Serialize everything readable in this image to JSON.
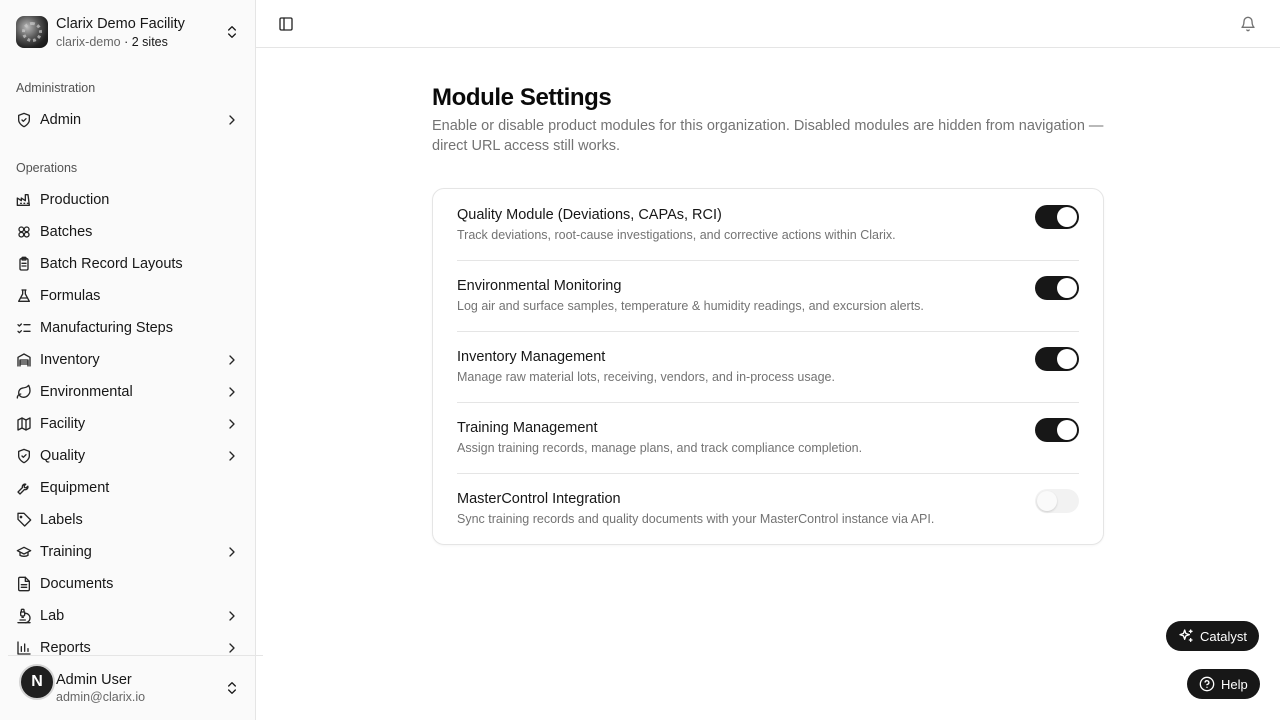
{
  "org": {
    "name": "Clarix Demo Facility",
    "slug": "clarix-demo",
    "sep": "·",
    "sites": "2 sites"
  },
  "sections": {
    "administration": "Administration",
    "operations": "Operations"
  },
  "admin_nav": [
    {
      "label": "Admin",
      "icon": "shield-check-icon",
      "expandable": true
    }
  ],
  "nav": [
    {
      "label": "Production",
      "icon": "factory-icon",
      "expandable": false
    },
    {
      "label": "Batches",
      "icon": "boxes-icon",
      "expandable": false
    },
    {
      "label": "Batch Record Layouts",
      "icon": "clipboard-icon",
      "expandable": false
    },
    {
      "label": "Formulas",
      "icon": "flask-icon",
      "expandable": false
    },
    {
      "label": "Manufacturing Steps",
      "icon": "list-checks-icon",
      "expandable": false
    },
    {
      "label": "Inventory",
      "icon": "warehouse-icon",
      "expandable": true
    },
    {
      "label": "Environmental",
      "icon": "leaf-icon",
      "expandable": true
    },
    {
      "label": "Facility",
      "icon": "map-icon",
      "expandable": true
    },
    {
      "label": "Quality",
      "icon": "shield-check-icon",
      "expandable": true
    },
    {
      "label": "Equipment",
      "icon": "wrench-icon",
      "expandable": false
    },
    {
      "label": "Labels",
      "icon": "tag-icon",
      "expandable": false
    },
    {
      "label": "Training",
      "icon": "graduation-cap-icon",
      "expandable": true
    },
    {
      "label": "Documents",
      "icon": "file-text-icon",
      "expandable": false
    },
    {
      "label": "Lab",
      "icon": "microscope-icon",
      "expandable": true
    },
    {
      "label": "Reports",
      "icon": "bar-chart-icon",
      "expandable": true
    }
  ],
  "user": {
    "initial": "N",
    "name": "Admin User",
    "email": "admin@clarix.io"
  },
  "page": {
    "title": "Module Settings",
    "description": "Enable or disable product modules for this organization. Disabled modules are hidden from navigation — direct URL access still works."
  },
  "modules": [
    {
      "title": "Quality Module (Deviations, CAPAs, RCI)",
      "description": "Track deviations, root-cause investigations, and corrective actions within Clarix.",
      "enabled": true
    },
    {
      "title": "Environmental Monitoring",
      "description": "Log air and surface samples, temperature & humidity readings, and excursion alerts.",
      "enabled": true
    },
    {
      "title": "Inventory Management",
      "description": "Manage raw material lots, receiving, vendors, and in-process usage.",
      "enabled": true
    },
    {
      "title": "Training Management",
      "description": "Assign training records, manage plans, and track compliance completion.",
      "enabled": true
    },
    {
      "title": "MasterControl Integration",
      "description": "Sync training records and quality documents with your MasterControl instance via API.",
      "enabled": false
    }
  ],
  "floating": {
    "catalyst": "Catalyst",
    "help": "Help"
  },
  "colors": {
    "accent": "#171717",
    "toggle_off": "#f0f0f0",
    "muted_text": "#737373",
    "border": "#e5e5e5"
  }
}
